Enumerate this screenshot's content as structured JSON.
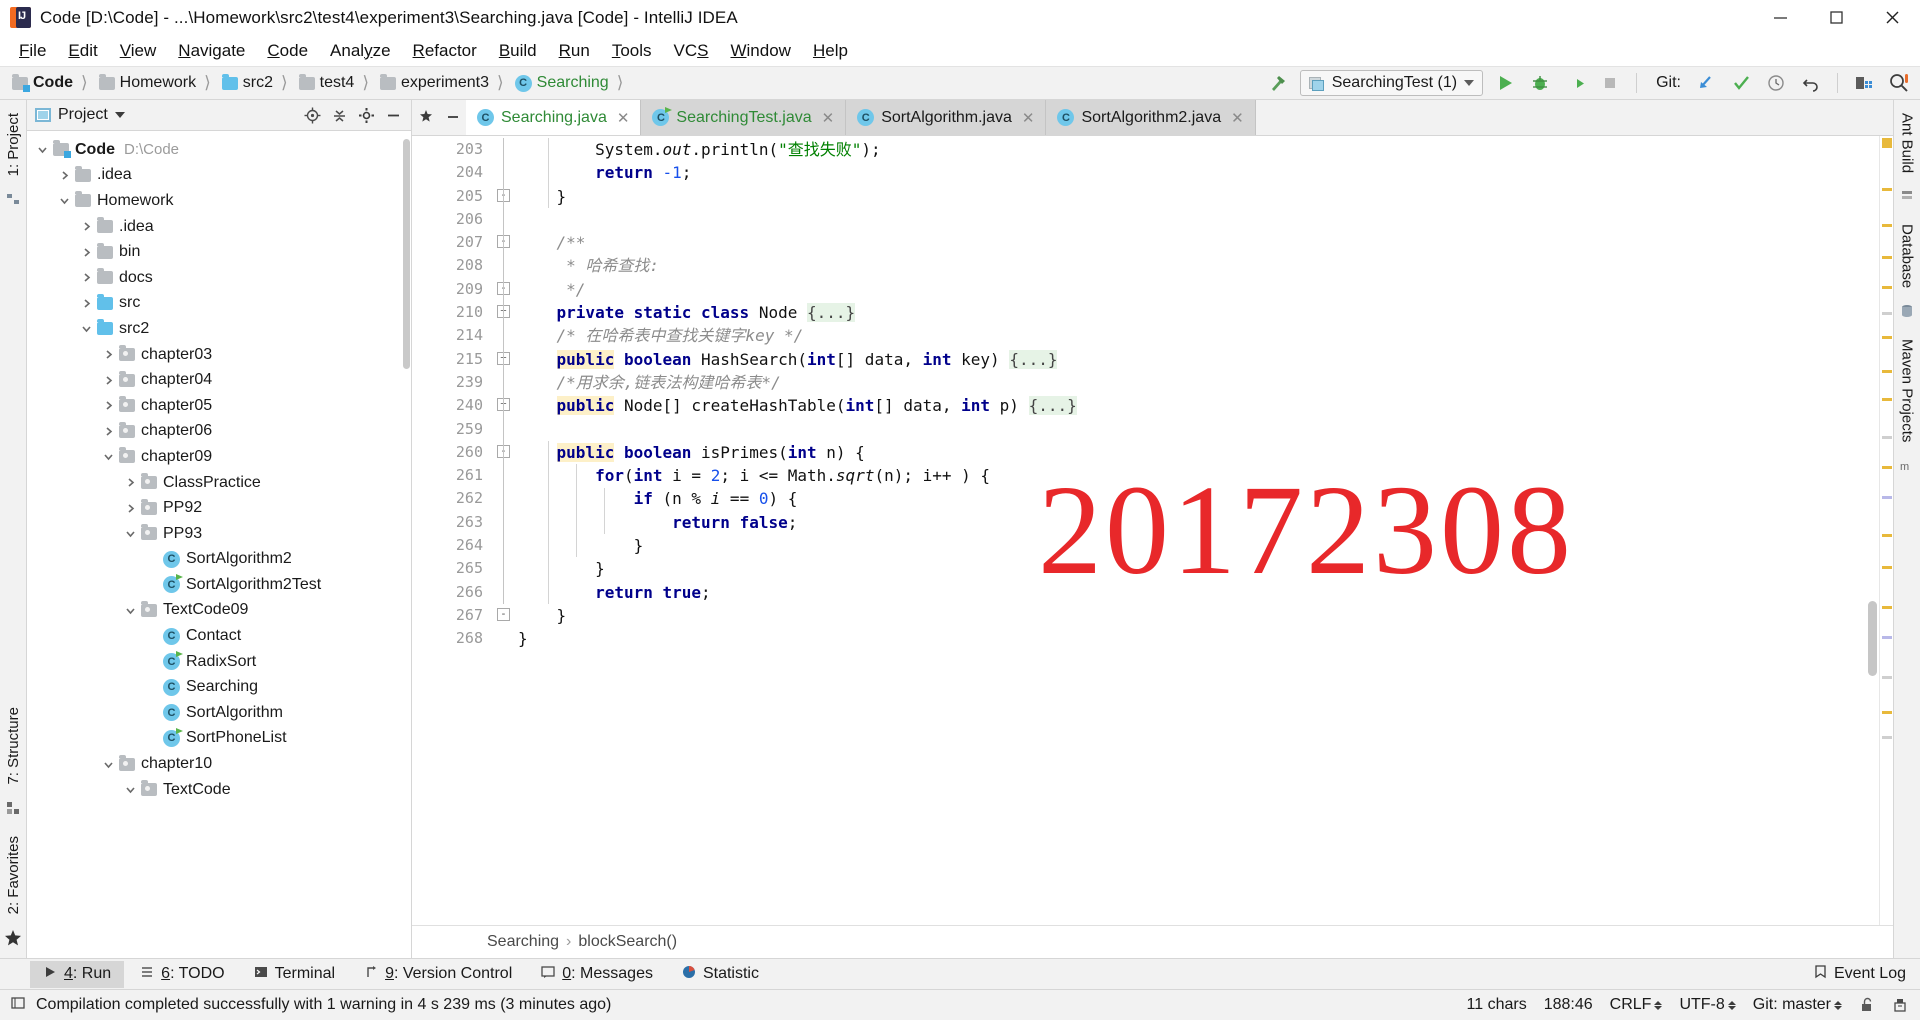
{
  "window": {
    "title": "Code [D:\\Code] - ...\\Homework\\src2\\test4\\experiment3\\Searching.java [Code] - IntelliJ IDEA",
    "minimize": "minimize-icon",
    "maximize": "maximize-icon",
    "close": "close-icon"
  },
  "menu": {
    "items": [
      {
        "label": "File",
        "mnemonic": "F"
      },
      {
        "label": "Edit",
        "mnemonic": "E"
      },
      {
        "label": "View",
        "mnemonic": "V"
      },
      {
        "label": "Navigate",
        "mnemonic": "N"
      },
      {
        "label": "Code",
        "mnemonic": "C"
      },
      {
        "label": "Analyze",
        "mnemonic": "y"
      },
      {
        "label": "Refactor",
        "mnemonic": "R"
      },
      {
        "label": "Build",
        "mnemonic": "B"
      },
      {
        "label": "Run",
        "mnemonic": "R"
      },
      {
        "label": "Tools",
        "mnemonic": "T"
      },
      {
        "label": "VCS",
        "mnemonic": "S"
      },
      {
        "label": "Window",
        "mnemonic": "W"
      },
      {
        "label": "Help",
        "mnemonic": "H"
      }
    ]
  },
  "navbar": {
    "crumbs": [
      {
        "label": "Code",
        "icon": "project-folder-icon",
        "bold": true
      },
      {
        "label": "Homework",
        "icon": "folder-icon",
        "bold": false
      },
      {
        "label": "src2",
        "icon": "source-folder-icon",
        "bold": false
      },
      {
        "label": "test4",
        "icon": "folder-icon",
        "bold": false
      },
      {
        "label": "experiment3",
        "icon": "folder-icon",
        "bold": false
      },
      {
        "label": "Searching",
        "icon": "java-class-icon",
        "bold": false
      }
    ],
    "run_config": "SearchingTest (1)",
    "git_label": "Git:",
    "buttons": [
      "build-hammer-icon",
      "run-icon",
      "debug-icon",
      "run-with-coverage-icon",
      "stop-icon",
      "update-project-icon",
      "commit-icon",
      "history-icon",
      "rollback-icon",
      "open-settings-icon",
      "search-everywhere-icon"
    ]
  },
  "left_rail": {
    "top": [
      "1: Project"
    ],
    "bottom": [
      "7: Structure",
      "2: Favorites"
    ]
  },
  "right_rail": {
    "items": [
      "Ant Build",
      "Database",
      "Maven Projects"
    ]
  },
  "project_panel": {
    "title": "Project",
    "header_icons": [
      "locate-icon",
      "collapse-all-icon",
      "settings-gear-icon",
      "hide-icon"
    ],
    "tree": [
      {
        "label": "Code",
        "path": "D:\\Code",
        "depth": 0,
        "state": "expanded",
        "icon": "project-root-icon",
        "bold": true
      },
      {
        "label": ".idea",
        "depth": 1,
        "state": "collapsed",
        "icon": "folder-icon"
      },
      {
        "label": "Homework",
        "depth": 1,
        "state": "expanded",
        "icon": "folder-icon"
      },
      {
        "label": ".idea",
        "depth": 2,
        "state": "collapsed",
        "icon": "folder-icon"
      },
      {
        "label": "bin",
        "depth": 2,
        "state": "collapsed",
        "icon": "folder-icon"
      },
      {
        "label": "docs",
        "depth": 2,
        "state": "collapsed",
        "icon": "folder-icon"
      },
      {
        "label": "src",
        "depth": 2,
        "state": "collapsed",
        "icon": "source-folder-icon"
      },
      {
        "label": "src2",
        "depth": 2,
        "state": "expanded",
        "icon": "source-folder-icon"
      },
      {
        "label": "chapter03",
        "depth": 3,
        "state": "collapsed",
        "icon": "package-icon"
      },
      {
        "label": "chapter04",
        "depth": 3,
        "state": "collapsed",
        "icon": "package-icon"
      },
      {
        "label": "chapter05",
        "depth": 3,
        "state": "collapsed",
        "icon": "package-icon"
      },
      {
        "label": "chapter06",
        "depth": 3,
        "state": "collapsed",
        "icon": "package-icon"
      },
      {
        "label": "chapter09",
        "depth": 3,
        "state": "expanded",
        "icon": "package-icon"
      },
      {
        "label": "ClassPractice",
        "depth": 4,
        "state": "collapsed",
        "icon": "package-icon"
      },
      {
        "label": "PP92",
        "depth": 4,
        "state": "collapsed",
        "icon": "package-icon"
      },
      {
        "label": "PP93",
        "depth": 4,
        "state": "expanded",
        "icon": "package-icon"
      },
      {
        "label": "SortAlgorithm2",
        "depth": 5,
        "state": "leaf",
        "icon": "java-class-icon"
      },
      {
        "label": "SortAlgorithm2Test",
        "depth": 5,
        "state": "leaf",
        "icon": "java-runnable-class-icon"
      },
      {
        "label": "TextCode09",
        "depth": 4,
        "state": "expanded",
        "icon": "package-icon"
      },
      {
        "label": "Contact",
        "depth": 5,
        "state": "leaf",
        "icon": "java-class-icon"
      },
      {
        "label": "RadixSort",
        "depth": 5,
        "state": "leaf",
        "icon": "java-runnable-class-icon"
      },
      {
        "label": "Searching",
        "depth": 5,
        "state": "leaf",
        "icon": "java-class-icon"
      },
      {
        "label": "SortAlgorithm",
        "depth": 5,
        "state": "leaf",
        "icon": "java-class-icon"
      },
      {
        "label": "SortPhoneList",
        "depth": 5,
        "state": "leaf",
        "icon": "java-runnable-class-icon"
      },
      {
        "label": "chapter10",
        "depth": 3,
        "state": "expanded",
        "icon": "package-icon"
      },
      {
        "label": "TextCode",
        "depth": 4,
        "state": "expanded",
        "icon": "package-icon"
      }
    ]
  },
  "editor": {
    "tabs": [
      {
        "label": "Searching.java",
        "icon": "java-class-icon",
        "active": true,
        "green": true
      },
      {
        "label": "SearchingTest.java",
        "icon": "java-runnable-class-icon",
        "active": false,
        "green": true
      },
      {
        "label": "SortAlgorithm.java",
        "icon": "java-class-icon",
        "active": false,
        "green": false
      },
      {
        "label": "SortAlgorithm2.java",
        "icon": "java-class-icon",
        "active": false,
        "green": false
      }
    ],
    "line_numbers": [
      "203",
      "204",
      "205",
      "206",
      "207",
      "208",
      "209",
      "210",
      "214",
      "215",
      "239",
      "240",
      "259",
      "260",
      "261",
      "262",
      "263",
      "264",
      "265",
      "266",
      "267",
      "268"
    ],
    "watermark": "20172308",
    "breadcrumb": [
      "Searching",
      "blockSearch()"
    ]
  },
  "code_lines": [
    {
      "num": "203",
      "indent": 4,
      "tokens": [
        {
          "t": "System.",
          "c": ""
        },
        {
          "t": "out",
          "c": "ital"
        },
        {
          "t": ".println(",
          "c": ""
        },
        {
          "t": "\"查找失败\"",
          "c": "str"
        },
        {
          "t": ");",
          "c": ""
        }
      ]
    },
    {
      "num": "204",
      "indent": 4,
      "tokens": [
        {
          "t": "return ",
          "c": "kw"
        },
        {
          "t": "-1",
          "c": "num"
        },
        {
          "t": ";",
          "c": ""
        }
      ]
    },
    {
      "num": "205",
      "indent": 2,
      "tokens": [
        {
          "t": "}",
          "c": ""
        }
      ]
    },
    {
      "num": "206",
      "indent": 0,
      "tokens": []
    },
    {
      "num": "207",
      "indent": 2,
      "tokens": [
        {
          "t": "/**",
          "c": "cmt"
        }
      ]
    },
    {
      "num": "208",
      "indent": 2,
      "tokens": [
        {
          "t": " * 哈希查找:",
          "c": "cmt"
        }
      ]
    },
    {
      "num": "209",
      "indent": 2,
      "tokens": [
        {
          "t": " */",
          "c": "cmt"
        }
      ]
    },
    {
      "num": "210",
      "indent": 2,
      "tokens": [
        {
          "t": "private static class ",
          "c": "kw"
        },
        {
          "t": "Node ",
          "c": ""
        },
        {
          "t": "{...}",
          "c": "fld"
        }
      ]
    },
    {
      "num": "214",
      "indent": 2,
      "tokens": [
        {
          "t": "/* 在哈希表中查找关键字key */",
          "c": "cmt"
        }
      ]
    },
    {
      "num": "215",
      "indent": 2,
      "tokens": [
        {
          "t": "public",
          "c": "kw hl"
        },
        {
          "t": " ",
          "c": ""
        },
        {
          "t": "boolean ",
          "c": "kw"
        },
        {
          "t": "HashSearch(",
          "c": ""
        },
        {
          "t": "int",
          "c": "kw"
        },
        {
          "t": "[] data, ",
          "c": ""
        },
        {
          "t": "int",
          "c": "kw"
        },
        {
          "t": " key) ",
          "c": ""
        },
        {
          "t": "{...}",
          "c": "fld"
        }
      ]
    },
    {
      "num": "239",
      "indent": 2,
      "tokens": [
        {
          "t": "/*用求余,链表法构建哈希表*/",
          "c": "cmt"
        }
      ]
    },
    {
      "num": "240",
      "indent": 2,
      "tokens": [
        {
          "t": "public",
          "c": "kw hl"
        },
        {
          "t": " Node[] createHashTable(",
          "c": ""
        },
        {
          "t": "int",
          "c": "kw"
        },
        {
          "t": "[] data, ",
          "c": ""
        },
        {
          "t": "int",
          "c": "kw"
        },
        {
          "t": " p) ",
          "c": ""
        },
        {
          "t": "{...}",
          "c": "fld"
        }
      ]
    },
    {
      "num": "259",
      "indent": 0,
      "tokens": []
    },
    {
      "num": "260",
      "indent": 2,
      "tokens": [
        {
          "t": "public",
          "c": "kw hl"
        },
        {
          "t": " ",
          "c": ""
        },
        {
          "t": "boolean ",
          "c": "kw"
        },
        {
          "t": "isPrimes(",
          "c": ""
        },
        {
          "t": "int",
          "c": "kw"
        },
        {
          "t": " n) {",
          "c": ""
        }
      ]
    },
    {
      "num": "261",
      "indent": 4,
      "tokens": [
        {
          "t": "for",
          "c": "kw"
        },
        {
          "t": "(",
          "c": ""
        },
        {
          "t": "int",
          "c": "kw"
        },
        {
          "t": " i = ",
          "c": ""
        },
        {
          "t": "2",
          "c": "num"
        },
        {
          "t": "; i <= Math.",
          "c": ""
        },
        {
          "t": "sqrt",
          "c": "ital"
        },
        {
          "t": "(n); i++ ) {",
          "c": ""
        }
      ]
    },
    {
      "num": "262",
      "indent": 6,
      "tokens": [
        {
          "t": "if",
          "c": "kw"
        },
        {
          "t": " (n % ",
          "c": ""
        },
        {
          "t": "i",
          "c": "ital"
        },
        {
          "t": " == ",
          "c": ""
        },
        {
          "t": "0",
          "c": "num"
        },
        {
          "t": ") {",
          "c": ""
        }
      ]
    },
    {
      "num": "263",
      "indent": 8,
      "tokens": [
        {
          "t": "return ",
          "c": "kw"
        },
        {
          "t": "false",
          "c": "kw"
        },
        {
          "t": ";",
          "c": ""
        }
      ]
    },
    {
      "num": "264",
      "indent": 6,
      "tokens": [
        {
          "t": "}",
          "c": ""
        }
      ]
    },
    {
      "num": "265",
      "indent": 4,
      "tokens": [
        {
          "t": "}",
          "c": ""
        }
      ]
    },
    {
      "num": "266",
      "indent": 4,
      "tokens": [
        {
          "t": "return ",
          "c": "kw"
        },
        {
          "t": "true",
          "c": "kw"
        },
        {
          "t": ";",
          "c": ""
        }
      ]
    },
    {
      "num": "267",
      "indent": 2,
      "tokens": [
        {
          "t": "}",
          "c": ""
        }
      ]
    },
    {
      "num": "268",
      "indent": 0,
      "tokens": [
        {
          "t": "}",
          "c": ""
        }
      ]
    }
  ],
  "bottom_tools": [
    {
      "label": "4: Run",
      "mnemonic": "4",
      "icon": "run-icon",
      "active": true
    },
    {
      "label": "6: TODO",
      "mnemonic": "6",
      "icon": "todo-icon",
      "active": false
    },
    {
      "label": "Terminal",
      "mnemonic": "",
      "icon": "terminal-icon",
      "active": false
    },
    {
      "label": "9: Version Control",
      "mnemonic": "9",
      "icon": "version-control-icon",
      "active": false
    },
    {
      "label": "0: Messages",
      "mnemonic": "0",
      "icon": "messages-icon",
      "active": false
    },
    {
      "label": "Statistic",
      "mnemonic": "",
      "icon": "statistic-icon",
      "active": false
    }
  ],
  "event_log": "Event Log",
  "statusbar": {
    "message": "Compilation completed successfully with 1 warning in 4 s 239 ms (3 minutes ago)",
    "chars": "11 chars",
    "caret": "188:46",
    "line_separator": "CRLF",
    "encoding": "UTF-8",
    "branch": "Git: master",
    "lock": "unlocked-icon",
    "inspector": "inspection-icon"
  },
  "colors": {
    "accent_green": "#2f8a36",
    "watermark_red": "#e8282a",
    "keyword_blue": "#00008b",
    "string_green": "#008000",
    "comment_gray": "#8c8c8c",
    "fold_bg": "#e6f3e6",
    "highlight_bg": "#fdf0c8"
  }
}
